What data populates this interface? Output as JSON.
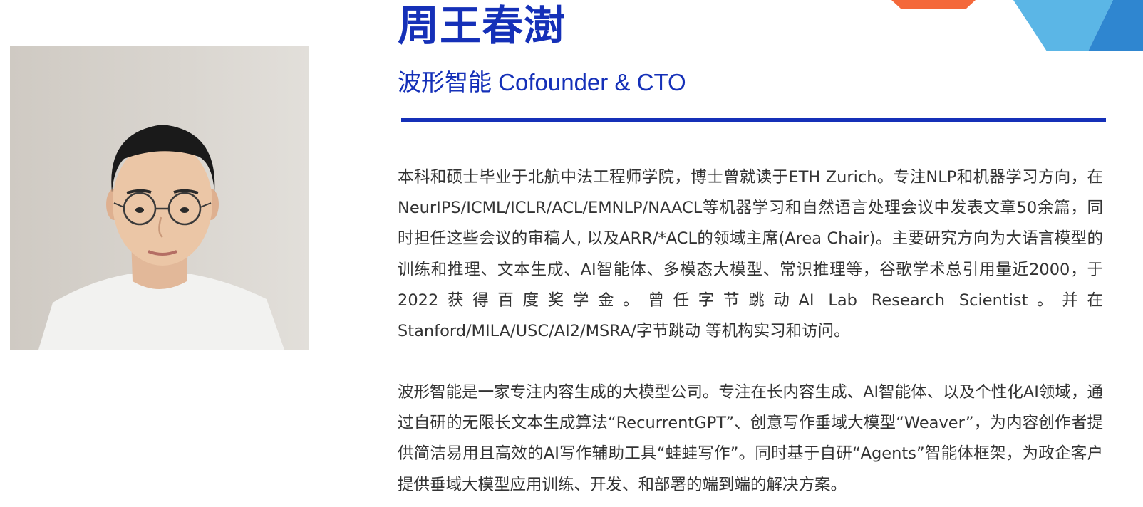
{
  "profile": {
    "name": "周王春澍",
    "title": "波形智能 Cofounder & CTO"
  },
  "bio": {
    "paragraph1": "本科和硕士毕业于北航中法工程师学院，博士曾就读于ETH Zurich。专注NLP和机器学习方向，在NeurIPS/ICML/ICLR/ACL/EMNLP/NAACL等机器学习和自然语言处理会议中发表文章50余篇，同时担任这些会议的审稿人, 以及ARR/*ACL的领域主席(Area Chair)。主要研究方向为大语言模型的训练和推理、文本生成、AI智能体、多模态大模型、常识推理等，谷歌学术总引用量近2000，于2022获得百度奖学金。曾任字节跳动AI Lab Research Scientist。并在Stanford/MILA/USC/AI2/MSRA/字节跳动 等机构实习和访问。",
    "paragraph2": "波形智能是一家专注内容生成的大模型公司。专注在长内容生成、AI智能体、以及个性化AI领域，通过自研的无限长文本生成算法“RecurrentGPT”、创意写作垂域大模型“Weaver”，为内容创作者提供简洁易用且高效的AI写作辅助工具“蛙蛙写作”。同时基于自研“Agents”智能体框架，为政企客户提供垂域大模型应用训练、开发、和部署的端到端的解决方案。"
  },
  "colors": {
    "accent": "#1530b8",
    "text": "#333333",
    "deco_orange": "#f4683a",
    "deco_lightblue": "#5bb6e6",
    "deco_blue": "#2f86d0"
  },
  "photo": {
    "icon": "portrait-photo"
  }
}
